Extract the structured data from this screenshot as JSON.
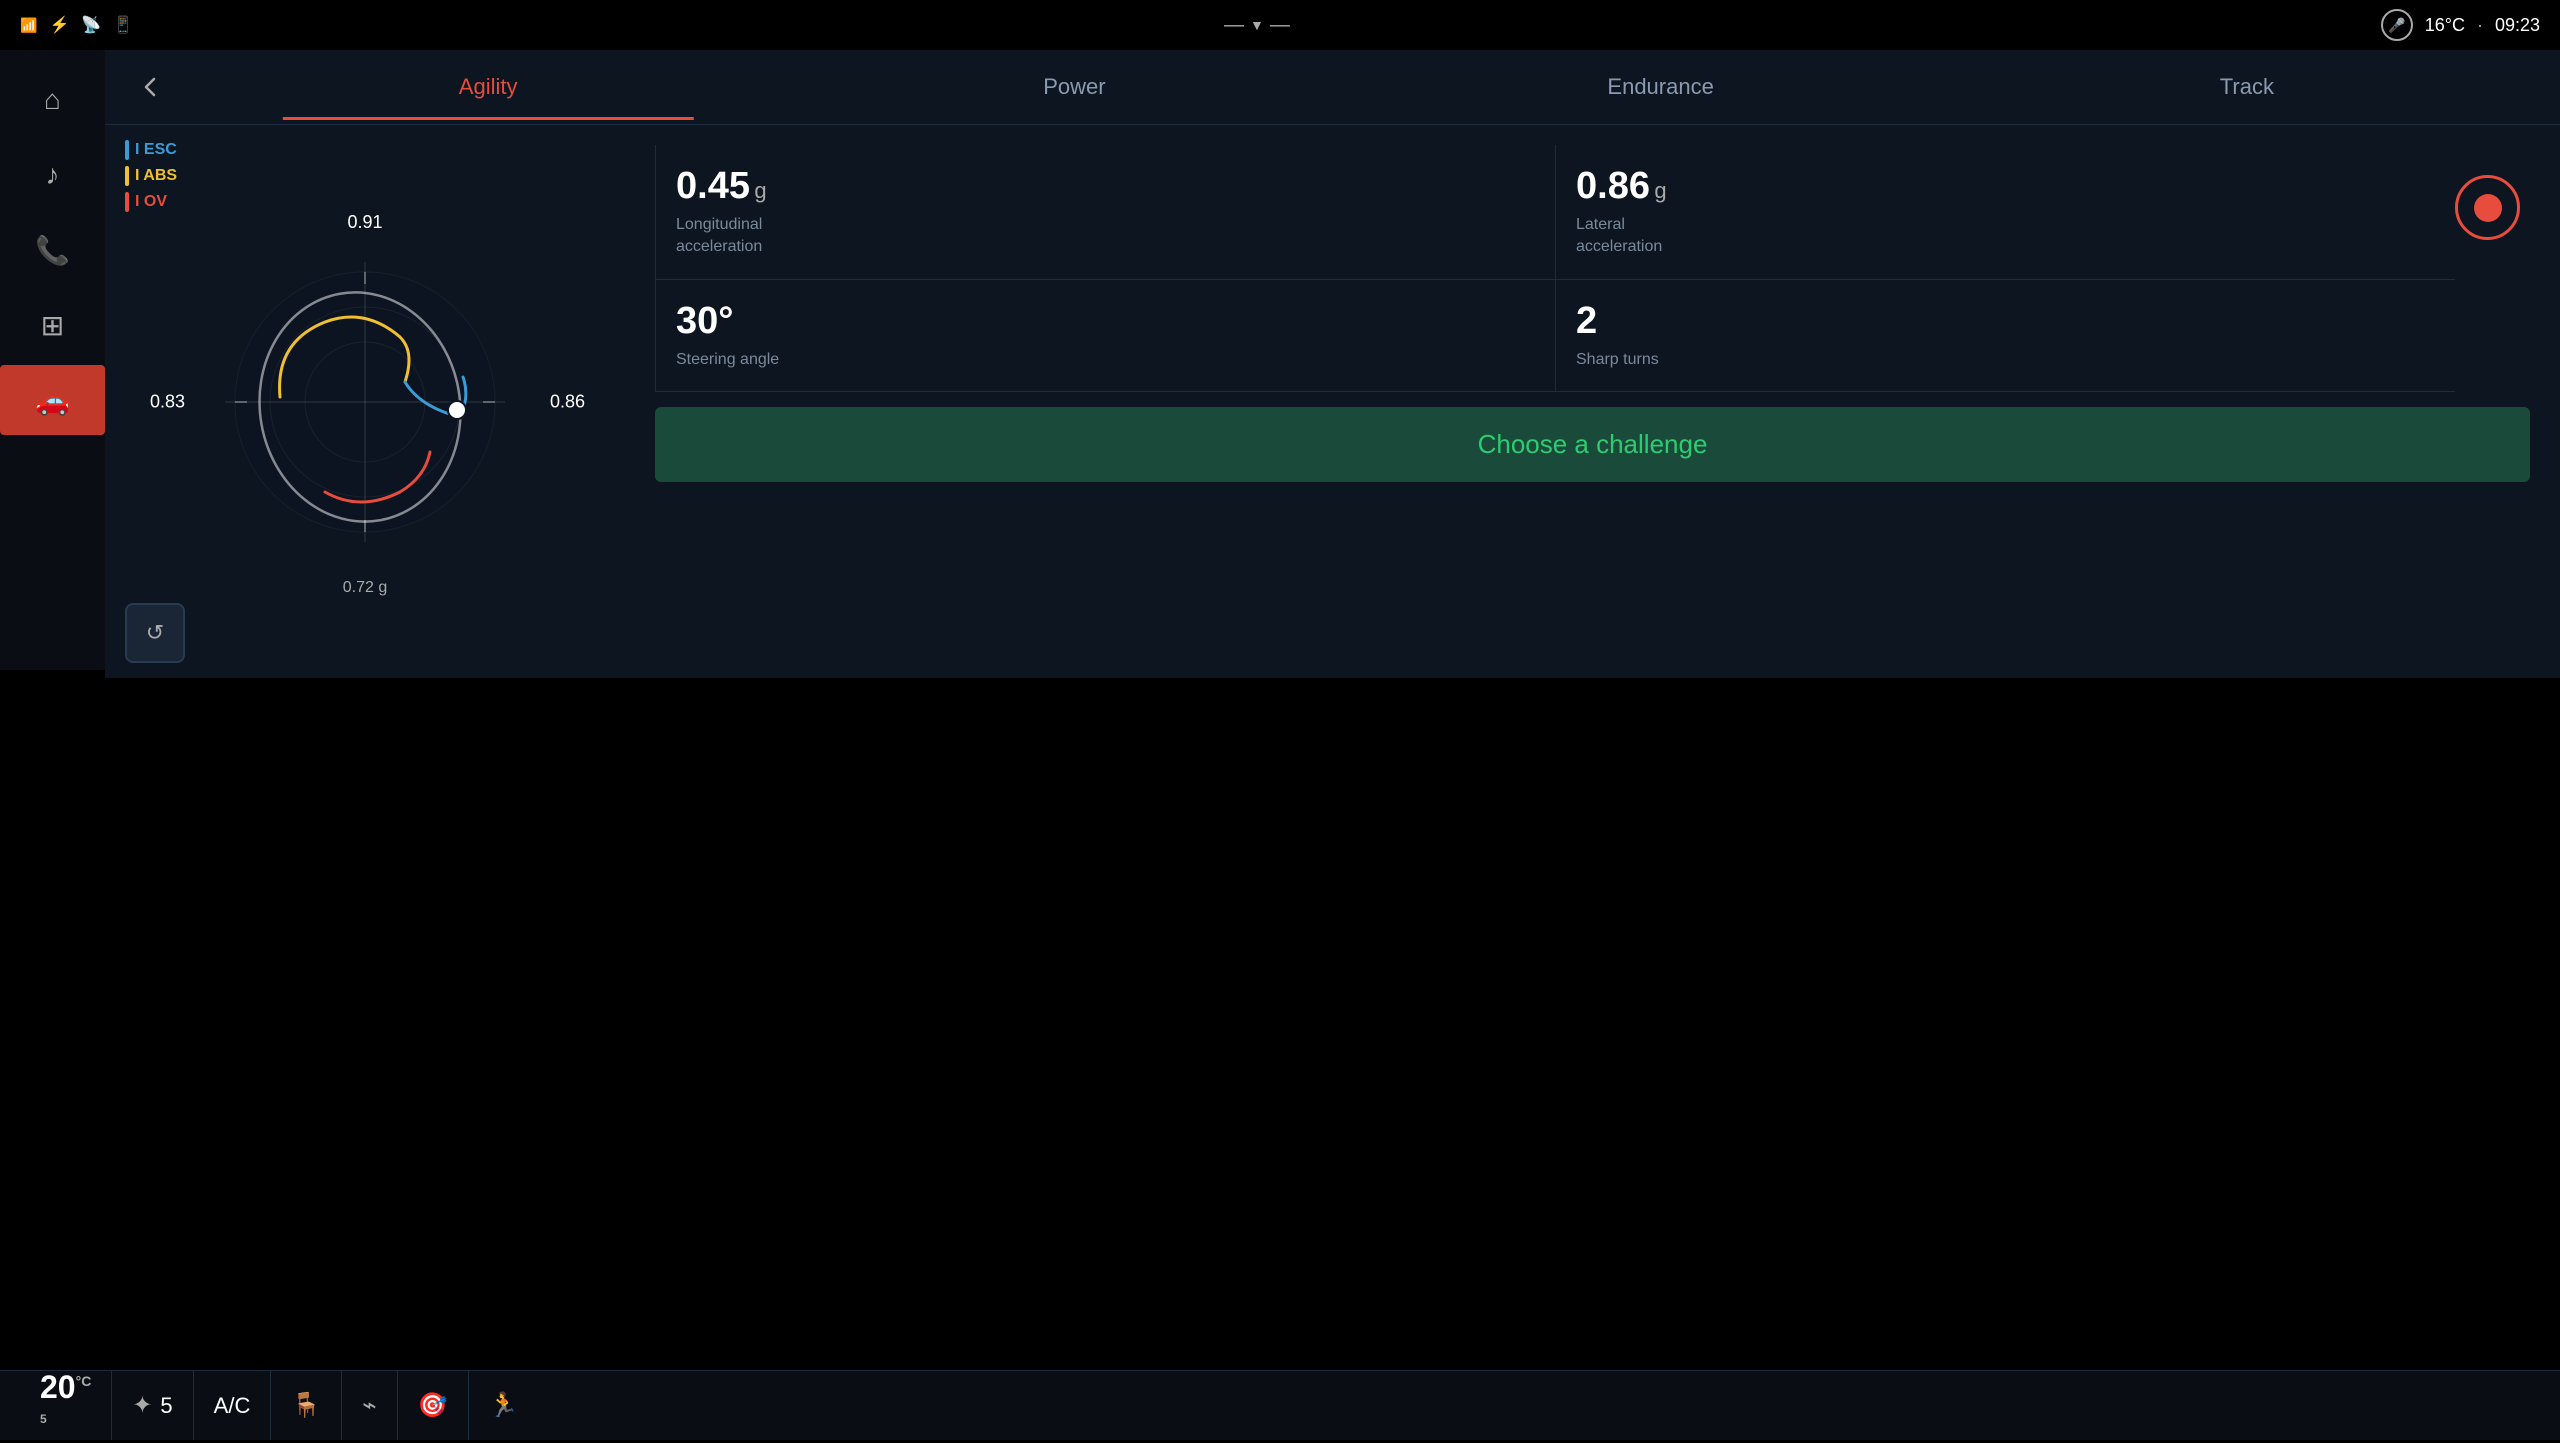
{
  "statusBar": {
    "temperature": "16°C",
    "time": "09:23",
    "separator": "·"
  },
  "nav": {
    "tabs": [
      {
        "id": "agility",
        "label": "Agility",
        "active": true
      },
      {
        "id": "power",
        "label": "Power",
        "active": false
      },
      {
        "id": "endurance",
        "label": "Endurance",
        "active": false
      },
      {
        "id": "track",
        "label": "Track",
        "active": false
      }
    ]
  },
  "legend": [
    {
      "id": "esc",
      "label": "I ESC",
      "color": "#3a9bd5"
    },
    {
      "id": "abs",
      "label": "I ABS",
      "color": "#f0c030"
    },
    {
      "id": "ov",
      "label": "I OV",
      "color": "#e74c3c"
    }
  ],
  "gauge": {
    "labelTop": "0.91",
    "labelBottom": "0.72 g",
    "labelLeft": "0.83",
    "labelRight": "0.86"
  },
  "stats": [
    {
      "value": "0.45",
      "unit": "g",
      "label": "Longitudinal\nacceleration"
    },
    {
      "value": "0.86",
      "unit": "g",
      "label": "Lateral\nacceleration"
    },
    {
      "value": "30°",
      "unit": "",
      "label": "Steering angle"
    },
    {
      "value": "2",
      "unit": "",
      "label": "Sharp turns"
    }
  ],
  "challengeBtn": "Choose a challenge",
  "bottomBar": {
    "temperature": "20",
    "tempUnit": "°C",
    "tempSub": "5",
    "fanSpeed": "5",
    "ac": "A/C"
  }
}
